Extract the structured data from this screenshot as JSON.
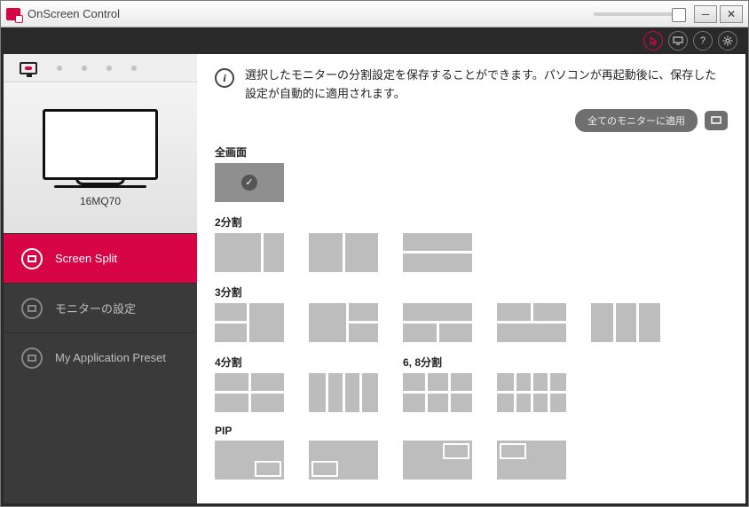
{
  "titlebar": {
    "title": "OnScreen Control"
  },
  "monitor": {
    "model": "16MQ70"
  },
  "nav": {
    "items": [
      {
        "label": "Screen Split"
      },
      {
        "label": "モニターの設定"
      },
      {
        "label": "My Application Preset"
      }
    ]
  },
  "description": "選択したモニターの分割設定を保存することができます。パソコンが再起動後に、保存した設定が自動的に適用されます。",
  "apply_all": "全てのモニターに適用",
  "sections": {
    "full": "全画面",
    "s2": "2分割",
    "s3": "3分割",
    "s4": "4分割",
    "s68": "6, 8分割",
    "pip": "PIP"
  }
}
